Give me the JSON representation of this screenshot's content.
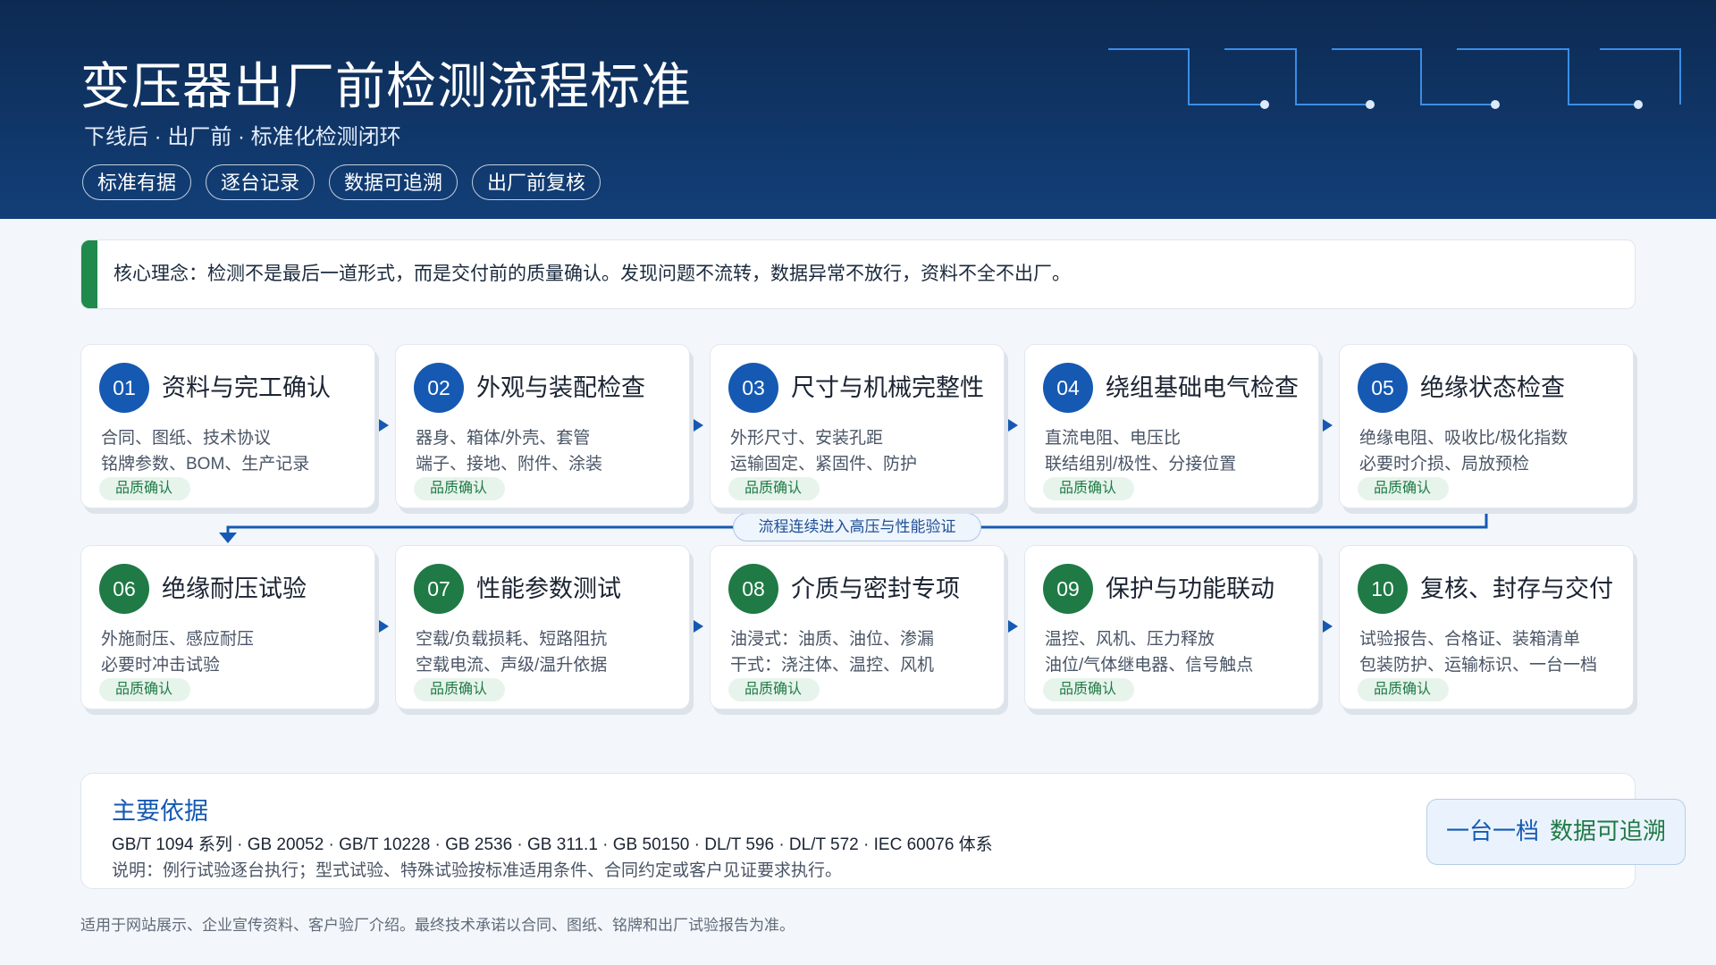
{
  "header": {
    "title": "变压器出厂前检测流程标准",
    "subtitle": "下线后 · 出厂前 · 标准化检测闭环",
    "tags": [
      "标准有据",
      "逐台记录",
      "数据可追溯",
      "出厂前复核"
    ]
  },
  "core": {
    "text": "核心理念：检测不是最后一道形式，而是交付前的质量确认。发现问题不流转，数据异常不放行，资料不全不出厂。"
  },
  "steps": [
    {
      "num": "01",
      "title": "资料与完工确认",
      "line1": "合同、图纸、技术协议",
      "line2": "铭牌参数、BOM、生产记录",
      "badge": "品质确认"
    },
    {
      "num": "02",
      "title": "外观与装配检查",
      "line1": "器身、箱体/外壳、套管",
      "line2": "端子、接地、附件、涂装",
      "badge": "品质确认"
    },
    {
      "num": "03",
      "title": "尺寸与机械完整性",
      "line1": "外形尺寸、安装孔距",
      "line2": "运输固定、紧固件、防护",
      "badge": "品质确认"
    },
    {
      "num": "04",
      "title": "绕组基础电气检查",
      "line1": "直流电阻、电压比",
      "line2": "联结组别/极性、分接位置",
      "badge": "品质确认"
    },
    {
      "num": "05",
      "title": "绝缘状态检查",
      "line1": "绝缘电阻、吸收比/极化指数",
      "line2": "必要时介损、局放预检",
      "badge": "品质确认"
    },
    {
      "num": "06",
      "title": "绝缘耐压试验",
      "line1": "外施耐压、感应耐压",
      "line2": "必要时冲击试验",
      "badge": "品质确认"
    },
    {
      "num": "07",
      "title": "性能参数测试",
      "line1": "空载/负载损耗、短路阻抗",
      "line2": "空载电流、声级/温升依据",
      "badge": "品质确认"
    },
    {
      "num": "08",
      "title": "介质与密封专项",
      "line1": "油浸式：油质、油位、渗漏",
      "line2": "干式：浇注体、温控、风机",
      "badge": "品质确认"
    },
    {
      "num": "09",
      "title": "保护与功能联动",
      "line1": "温控、风机、压力释放",
      "line2": "油位/气体继电器、信号触点",
      "badge": "品质确认"
    },
    {
      "num": "10",
      "title": "复核、封存与交付",
      "line1": "试验报告、合格证、装箱清单",
      "line2": "包装防护、运输标识、一台一档",
      "badge": "品质确认"
    }
  ],
  "flow_label": "流程连续进入高压与性能验证",
  "basis": {
    "title": "主要依据",
    "standards": "GB/T 1094 系列 · GB 20052 · GB/T 10228 · GB 2536 · GB 311.1 · GB 50150 · DL/T 596 · DL/T 572 · IEC 60076 体系",
    "note": "说明：例行试验逐台执行；型式试验、特殊试验按标准适用条件、合同约定或客户见证要求执行。"
  },
  "traceability": {
    "part1": "一台一档",
    "part2": "数据可追溯"
  },
  "footer": "适用于网站展示、企业宣传资料、客户验厂介绍。最终技术承诺以合同、图纸、铭牌和出厂试验报告为准。",
  "colors": {
    "blue": "#1559b3",
    "green": "#1f7a45",
    "header_dark": "#0d2a52",
    "accent_line": "#3a8ee6"
  }
}
